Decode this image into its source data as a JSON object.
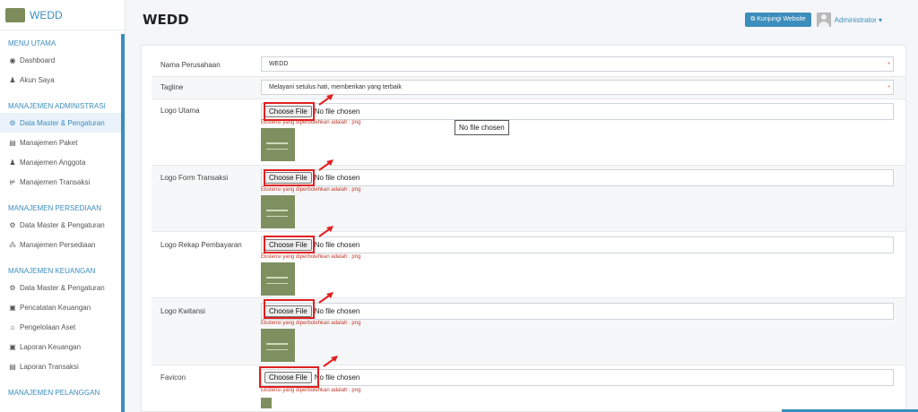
{
  "app": {
    "name": "WEDD"
  },
  "sidebar": {
    "sections": [
      {
        "header": "MENU UTAMA",
        "items": [
          {
            "label": "Dashboard",
            "icon": "palette-icon",
            "glyph": "◉"
          },
          {
            "label": "Akun Saya",
            "icon": "user-icon",
            "glyph": "♟"
          }
        ]
      },
      {
        "header": "MANAJEMEN ADMINISTRASI",
        "items": [
          {
            "label": "Data Master & Pengaturan",
            "icon": "cogs-icon",
            "glyph": "⚙",
            "active": true
          },
          {
            "label": "Manajemen Paket",
            "icon": "book-icon",
            "glyph": "▤"
          },
          {
            "label": "Manajemen Anggota",
            "icon": "users-icon",
            "glyph": "♟"
          },
          {
            "label": "Manajemen Transaksi",
            "icon": "dolly-icon",
            "glyph": "⊭"
          }
        ]
      },
      {
        "header": "MANAJEMEN PERSEDIAAN",
        "items": [
          {
            "label": "Data Master & Pengaturan",
            "icon": "cogs-icon",
            "glyph": "⚙"
          },
          {
            "label": "Manajemen Persediaan",
            "icon": "boxes-icon",
            "glyph": "⁂"
          }
        ]
      },
      {
        "header": "MANAJEMEN KEUANGAN",
        "items": [
          {
            "label": "Data Master & Pengaturan",
            "icon": "cogs-icon",
            "glyph": "⚙"
          },
          {
            "label": "Pencatatan Keuangan",
            "icon": "money-icon",
            "glyph": "▣"
          },
          {
            "label": "Pengelolaan Aset",
            "icon": "box-icon",
            "glyph": "⌂"
          },
          {
            "label": "Laporan Keuangan",
            "icon": "money-icon",
            "glyph": "▣"
          },
          {
            "label": "Laporan Transaksi",
            "icon": "book-icon",
            "glyph": "▤"
          }
        ]
      },
      {
        "header": "MANAJEMEN PELANGGAN",
        "items": []
      }
    ]
  },
  "header": {
    "title": "WEDD",
    "visit_button": "Kunjungi Website",
    "user_name": "Administrator ▾"
  },
  "form": {
    "company_name": {
      "label": "Nama Perusahaan",
      "value": "WEDD"
    },
    "tagline": {
      "label": "Tagline",
      "value": "Melayani setulus hati, memberikan yang terbaik"
    },
    "file_fields": [
      {
        "label": "Logo Utama"
      },
      {
        "label": "Logo Form Transaksi"
      },
      {
        "label": "Logo Rekap Pembayaran"
      },
      {
        "label": "Logo Kwitansi"
      },
      {
        "label": "Favicon"
      }
    ],
    "choose_label": "Choose File",
    "no_file_label": "No file chosen",
    "hint": "Ekstensi yang diperbolehkan adalah : png",
    "required_mark": "*"
  },
  "tooltip": "No file chosen",
  "colors": {
    "accent": "#3c8dbc",
    "annotation": "#e02020",
    "hint": "#c0392b"
  }
}
